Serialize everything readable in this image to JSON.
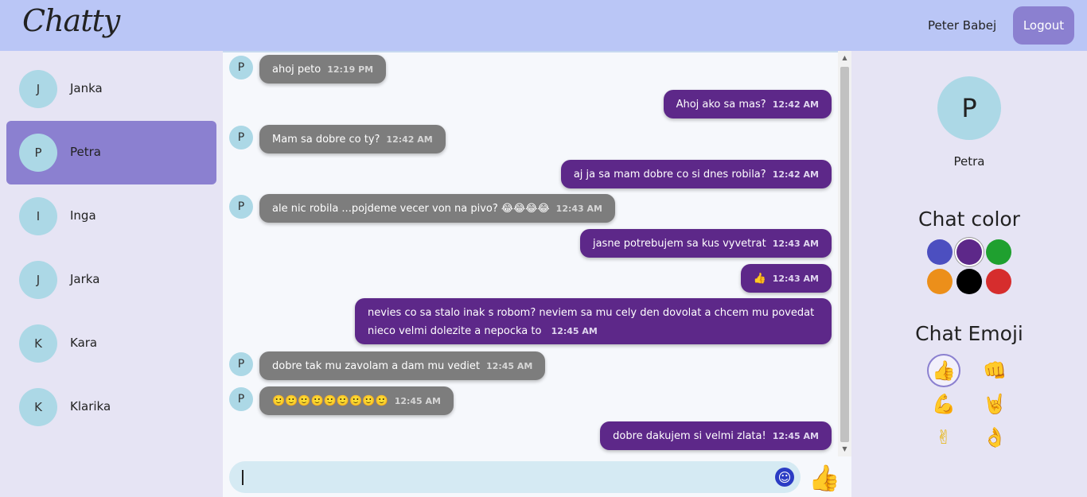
{
  "header": {
    "logo": "Chatty",
    "username": "Peter Babej",
    "logout_label": "Logout"
  },
  "contacts": [
    {
      "initial": "J",
      "name": "Janka"
    },
    {
      "initial": "P",
      "name": "Petra"
    },
    {
      "initial": "I",
      "name": "Inga"
    },
    {
      "initial": "J",
      "name": "Jarka"
    },
    {
      "initial": "K",
      "name": "Kara"
    },
    {
      "initial": "K",
      "name": "Klarika"
    }
  ],
  "messages": [
    {
      "from": "them",
      "avatar": "P",
      "text": "ahoj peto",
      "time": "12:19 PM"
    },
    {
      "from": "me",
      "text": "Ahoj ako sa mas?",
      "time": "12:42 AM"
    },
    {
      "from": "them",
      "avatar": "P",
      "text": "Mam sa dobre co ty?",
      "time": "12:42 AM"
    },
    {
      "from": "me",
      "text": "aj ja sa mam dobre co si dnes robila?",
      "time": "12:42 AM"
    },
    {
      "from": "them",
      "avatar": "P",
      "text": "ale nic robila ...pojdeme vecer von na pivo? 😂😂😂😂",
      "time": "12:43 AM"
    },
    {
      "from": "me",
      "text": "jasne potrebujem sa kus vyvetrat",
      "time": "12:43 AM"
    },
    {
      "from": "me",
      "text": "👍",
      "time": "12:43 AM"
    },
    {
      "from": "me",
      "text": "nevies co sa stalo inak s robom? neviem sa mu cely den dovolat a chcem mu povedat nieco velmi dolezite a nepocka to",
      "time": "12:45 AM"
    },
    {
      "from": "them",
      "avatar": "P",
      "text": "dobre tak mu zavolam a dam mu vediet",
      "time": "12:45 AM"
    },
    {
      "from": "them",
      "avatar": "P",
      "text": "🙂🙂🙂🙂🙂🙂🙂🙂🙂",
      "time": "12:45 AM"
    },
    {
      "from": "me",
      "text": "dobre dakujem si velmi zlata!",
      "time": "12:45 AM"
    }
  ],
  "composer": {
    "value": "",
    "emoji_icon": "smiley-icon",
    "send_icon": "thumbs-up-icon"
  },
  "profile": {
    "initial": "P",
    "name": "Petra"
  },
  "chat_color": {
    "title": "Chat color",
    "selected": "#5d2889",
    "options": [
      "#4c4fc0",
      "#5d2889",
      "#1fa02f",
      "#ec8f1a",
      "#000000",
      "#d62d2d"
    ]
  },
  "chat_emoji": {
    "title": "Chat Emoji",
    "selected": "thumbs-up",
    "options": [
      {
        "icon": "thumbs-up-icon",
        "glyph": "👍"
      },
      {
        "icon": "fist-icon",
        "glyph": "👊"
      },
      {
        "icon": "flexed-biceps-icon",
        "glyph": "💪"
      },
      {
        "icon": "rock-on-icon",
        "glyph": "🤘"
      },
      {
        "icon": "victory-hand-icon",
        "glyph": "✌"
      },
      {
        "icon": "ok-hand-icon",
        "glyph": "👌"
      }
    ]
  }
}
